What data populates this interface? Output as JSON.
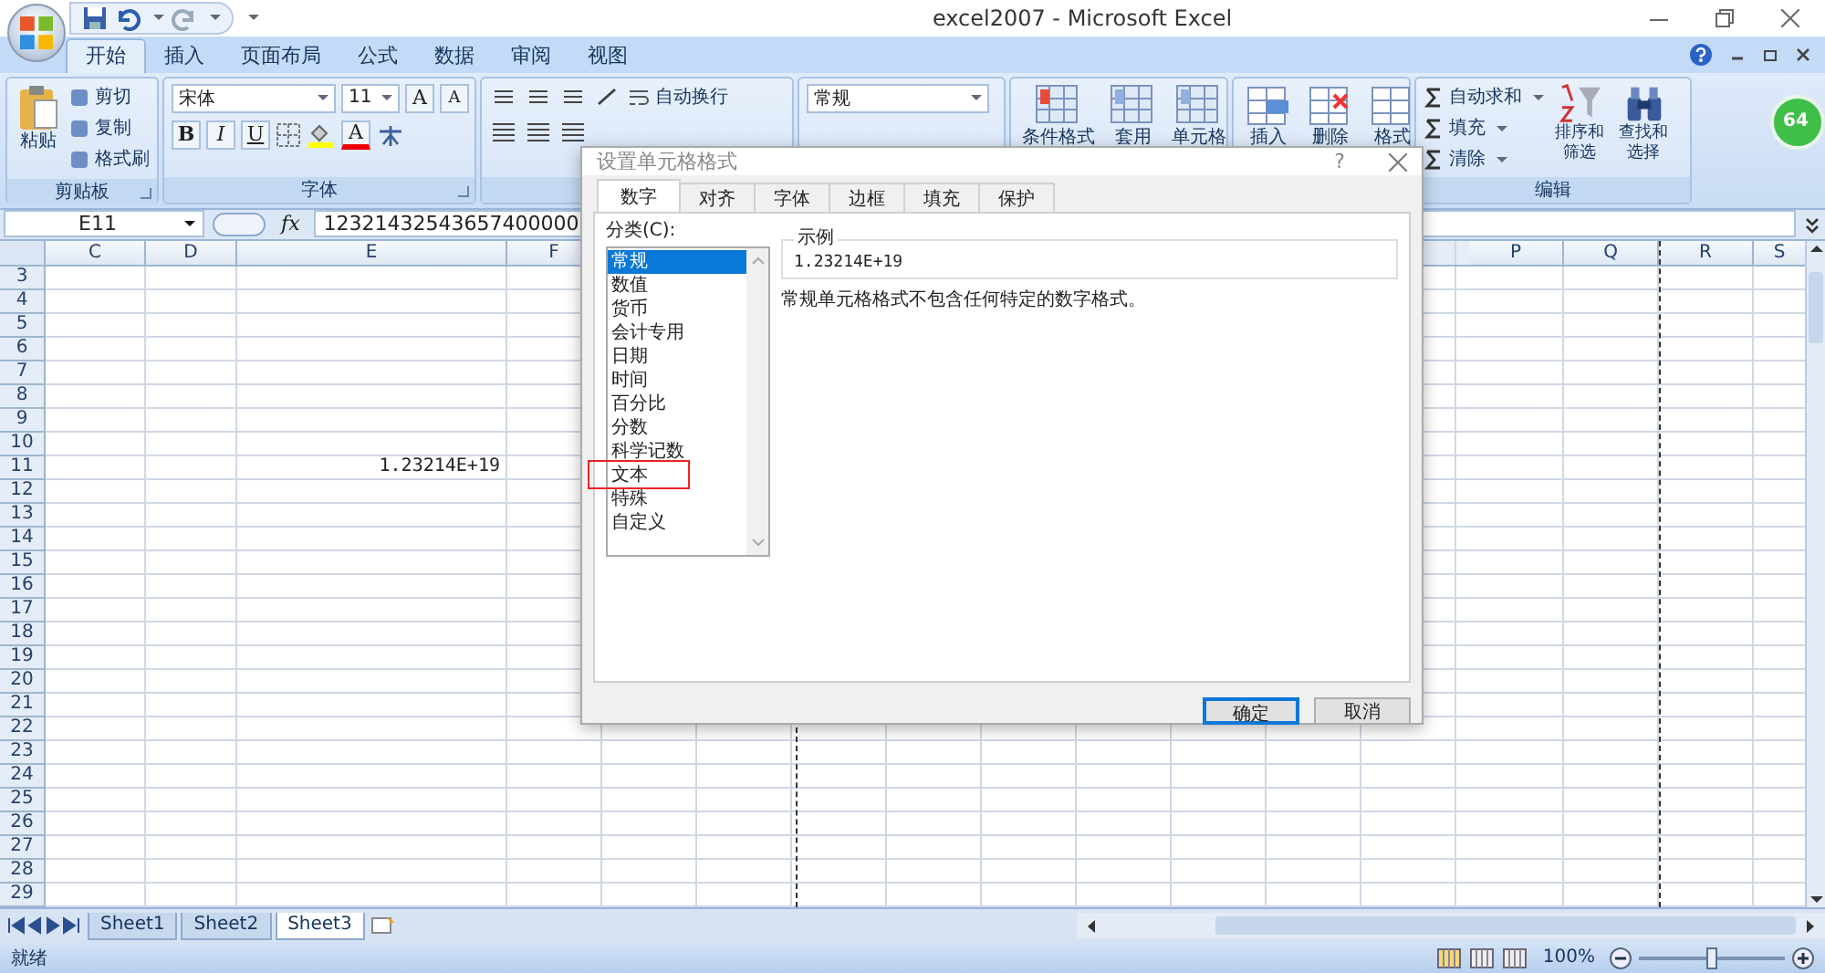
{
  "window": {
    "title": "excel2007 - Microsoft Excel"
  },
  "tabs": [
    {
      "label": "开始",
      "selected": true
    },
    {
      "label": "插入",
      "selected": false
    },
    {
      "label": "页面布局",
      "selected": false
    },
    {
      "label": "公式",
      "selected": false
    },
    {
      "label": "数据",
      "selected": false
    },
    {
      "label": "审阅",
      "selected": false
    },
    {
      "label": "视图",
      "selected": false
    }
  ],
  "ribbon": {
    "clipboard": {
      "label": "剪贴板",
      "paste": "粘贴",
      "commands": [
        "剪切",
        "复制",
        "格式刷"
      ]
    },
    "font": {
      "label": "字体",
      "font_name": "宋体",
      "font_size": "11",
      "grow": "A",
      "shrink": "A",
      "bold": "B",
      "italic": "I",
      "underline": "U",
      "font_color": "A"
    },
    "alignment": {
      "wrap_text": "自动换行"
    },
    "number": {
      "format": "常规"
    },
    "styles": {
      "commands": [
        "条件格式",
        "套用",
        "单元格"
      ]
    },
    "cells": {
      "commands": [
        "插入",
        "删除",
        "格式"
      ]
    },
    "editing": {
      "label": "编辑",
      "commands": [
        "自动求和",
        "填充",
        "清除"
      ],
      "sort": [
        "排序和",
        "筛选"
      ],
      "find": [
        "查找和",
        "选择"
      ]
    }
  },
  "badge": "64",
  "formula_bar": {
    "name_box": "E11",
    "fx": "fx",
    "value": "12321432543657400000"
  },
  "sheet": {
    "columns": [
      "C",
      "D",
      "E",
      "F",
      "P",
      "Q",
      "R",
      "S"
    ],
    "rows": [
      {
        "number": "3"
      },
      {
        "number": "4"
      },
      {
        "number": "5"
      },
      {
        "number": "6"
      },
      {
        "number": "7"
      },
      {
        "number": "8"
      },
      {
        "number": "9"
      },
      {
        "number": "10"
      },
      {
        "number": "11",
        "values": {
          "E": "1.23214E+19"
        }
      },
      {
        "number": "12"
      },
      {
        "number": "13"
      },
      {
        "number": "14"
      },
      {
        "number": "15"
      },
      {
        "number": "16"
      },
      {
        "number": "17"
      },
      {
        "number": "18"
      },
      {
        "number": "19"
      },
      {
        "number": "20"
      },
      {
        "number": "21"
      },
      {
        "number": "22"
      },
      {
        "number": "23"
      },
      {
        "number": "24"
      },
      {
        "number": "25"
      },
      {
        "number": "26"
      },
      {
        "number": "27"
      },
      {
        "number": "28"
      },
      {
        "number": "29"
      }
    ]
  },
  "sheet_tabs": [
    {
      "label": "Sheet1",
      "selected": false
    },
    {
      "label": "Sheet2",
      "selected": false
    },
    {
      "label": "Sheet3",
      "selected": true
    }
  ],
  "status_bar": {
    "status": "就绪",
    "zoom": "100%",
    "zoom_slider": {
      "level": 0.5
    }
  },
  "dialog": {
    "title": "设置单元格格式",
    "help": "?",
    "tabs": [
      {
        "label": "数字",
        "selected": true
      },
      {
        "label": "对齐",
        "selected": false
      },
      {
        "label": "字体",
        "selected": false
      },
      {
        "label": "边框",
        "selected": false
      },
      {
        "label": "填充",
        "selected": false
      },
      {
        "label": "保护",
        "selected": false
      }
    ],
    "category_label": "分类(C):",
    "categories": [
      {
        "label": "常规",
        "selected": true,
        "highlighted": false
      },
      {
        "label": "数值",
        "selected": false,
        "highlighted": false
      },
      {
        "label": "货币",
        "selected": false,
        "highlighted": false
      },
      {
        "label": "会计专用",
        "selected": false,
        "highlighted": false
      },
      {
        "label": "日期",
        "selected": false,
        "highlighted": false
      },
      {
        "label": "时间",
        "selected": false,
        "highlighted": false
      },
      {
        "label": "百分比",
        "selected": false,
        "highlighted": false
      },
      {
        "label": "分数",
        "selected": false,
        "highlighted": false
      },
      {
        "label": "科学记数",
        "selected": false,
        "highlighted": false
      },
      {
        "label": "文本",
        "selected": false,
        "highlighted": true
      },
      {
        "label": "特殊",
        "selected": false,
        "highlighted": false
      },
      {
        "label": "自定义",
        "selected": false,
        "highlighted": false
      }
    ],
    "sample_label": "示例",
    "sample": "1.23214E+19",
    "description": "常规单元格格式不包含任何特定的数字格式。",
    "buttons": [
      {
        "label": "确定",
        "default": true
      },
      {
        "label": "取消",
        "default": false
      }
    ]
  }
}
